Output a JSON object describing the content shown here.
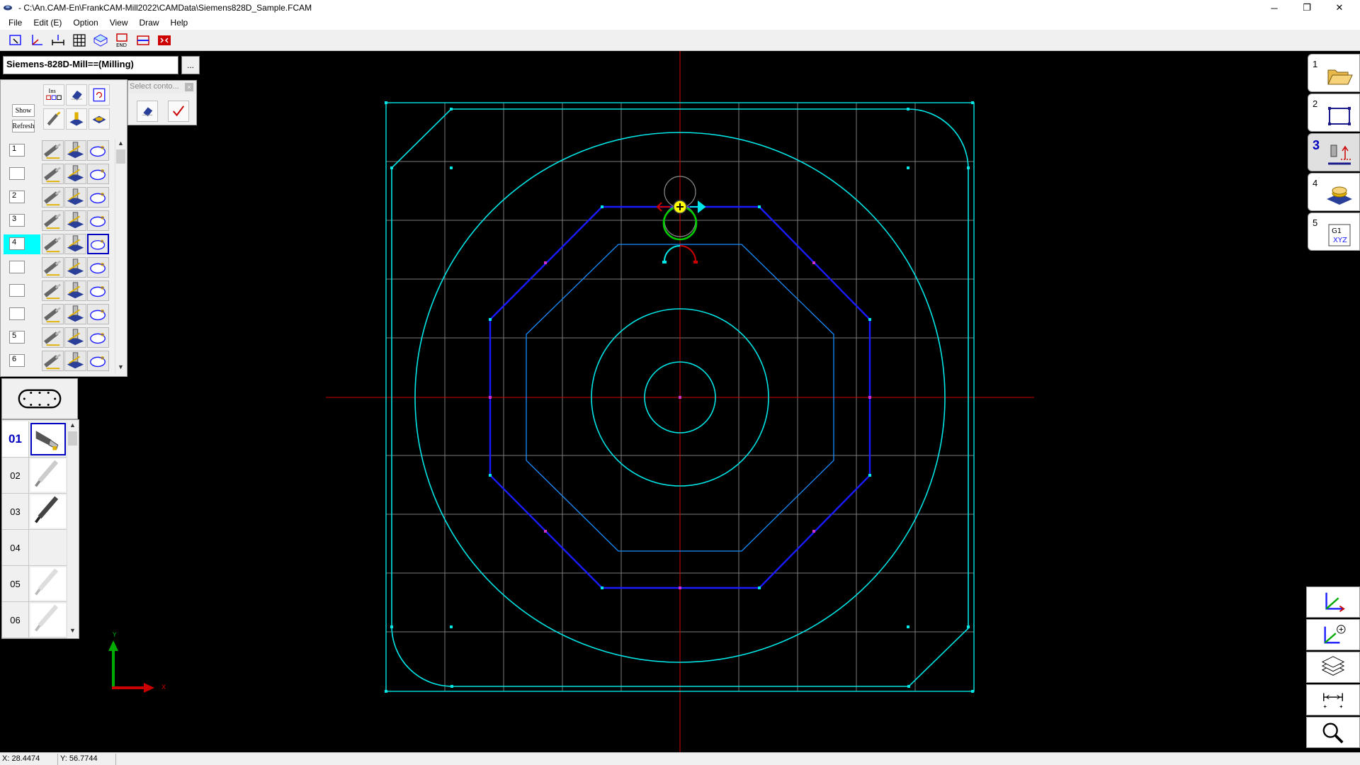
{
  "window": {
    "title": "- C:\\An.CAM-En\\FrankCAM-Mill2022\\CAMData\\Siemens828D_Sample.FCAM",
    "minimize": "─",
    "restore": "❐",
    "close": "✕"
  },
  "menu": {
    "items": [
      {
        "label": "File"
      },
      {
        "label": "Edit (E)"
      },
      {
        "label": "Option"
      },
      {
        "label": "View"
      },
      {
        "label": "Draw"
      },
      {
        "label": "Help"
      }
    ]
  },
  "toolbar": {
    "buttons": [
      "zoom-window-icon",
      "axis-xyz-icon",
      "dimension-icon",
      "grid-icon",
      "3d-view-icon",
      "end-icon",
      "sim-icon",
      "fit-icon"
    ],
    "end_label": "END"
  },
  "machine": {
    "value": "Siemens-828D-Mill==(Milling)",
    "more_label": "..."
  },
  "ops_panel": {
    "ins_label": "Ins",
    "show_label": "Show",
    "refresh_label": "Refresh",
    "rows": [
      {
        "num": "1",
        "active": false
      },
      {
        "num": "",
        "active": false
      },
      {
        "num": "2",
        "active": false
      },
      {
        "num": "3",
        "active": false
      },
      {
        "num": "4",
        "active": true
      },
      {
        "num": "",
        "active": false
      },
      {
        "num": "",
        "active": false
      },
      {
        "num": "",
        "active": false
      },
      {
        "num": "5",
        "active": false
      },
      {
        "num": "6",
        "active": false
      }
    ]
  },
  "select_contour": {
    "title": "Select conto...",
    "close": "×"
  },
  "tools": {
    "rows": [
      {
        "num": "01",
        "selected": true
      },
      {
        "num": "02",
        "selected": false
      },
      {
        "num": "03",
        "selected": false
      },
      {
        "num": "04",
        "selected": false
      },
      {
        "num": "05",
        "selected": false
      },
      {
        "num": "06",
        "selected": false
      }
    ]
  },
  "steps": [
    {
      "num": "1",
      "icon": "folder-open-icon",
      "active": false
    },
    {
      "num": "2",
      "icon": "rectangle-icon",
      "active": false
    },
    {
      "num": "3",
      "icon": "tool-setup-icon",
      "active": true
    },
    {
      "num": "4",
      "icon": "stock-icon",
      "active": false
    },
    {
      "num": "5",
      "icon": "gcode-icon",
      "active": false
    }
  ],
  "gcode_icon_text": {
    "line1": "G1",
    "line2": "XYZ"
  },
  "axis_labels": {
    "x": "X",
    "y": "Y"
  },
  "status": {
    "x": "X: 28.4474",
    "y": "Y: 56.7744"
  },
  "colors": {
    "canvas_bg": "#000000",
    "grid": "#808080",
    "cyan": "#00e5e5",
    "blue": "#1a1aff",
    "axis_red": "#cc0000"
  }
}
